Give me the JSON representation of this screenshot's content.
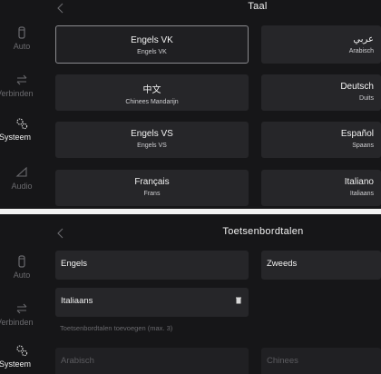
{
  "screen1": {
    "title": "Taal",
    "sidebar": [
      {
        "icon": "phone-icon",
        "label": "Auto",
        "active": false
      },
      {
        "icon": "connect-arrows-icon",
        "label": "Verbinden",
        "active": false
      },
      {
        "icon": "settings-gears-icon",
        "label": "Systeem",
        "active": true
      },
      {
        "icon": "speaker-icon",
        "label": "Audio",
        "active": false
      }
    ],
    "languages": [
      {
        "name": "Engels VK",
        "sub": "Engels VK",
        "selected": true
      },
      {
        "name": "عربي",
        "sub": "Arabisch",
        "selected": false
      },
      {
        "name": "中文",
        "sub": "Chinees Mandarijn",
        "selected": false
      },
      {
        "name": "Deutsch",
        "sub": "Duits",
        "selected": false
      },
      {
        "name": "Engels VS",
        "sub": "Engels VS",
        "selected": false
      },
      {
        "name": "Español",
        "sub": "Spaans",
        "selected": false
      },
      {
        "name": "Français",
        "sub": "Frans",
        "selected": false
      },
      {
        "name": "Italiano",
        "sub": "Italiaans",
        "selected": false
      }
    ]
  },
  "screen2": {
    "title": "Toetsenbordtalen",
    "sidebar": [
      {
        "icon": "phone-icon",
        "label": "Auto",
        "active": false
      },
      {
        "icon": "connect-arrows-icon",
        "label": "Verbinden",
        "active": false
      },
      {
        "icon": "settings-gears-icon",
        "label": "Systeem",
        "active": true
      }
    ],
    "keyboards": [
      "Engels",
      "Zweeds",
      "Italiaans"
    ],
    "hint": "Toetsenbordtalen toevoegen (max. 3)",
    "available": [
      "Arabisch",
      "Chinees"
    ]
  }
}
